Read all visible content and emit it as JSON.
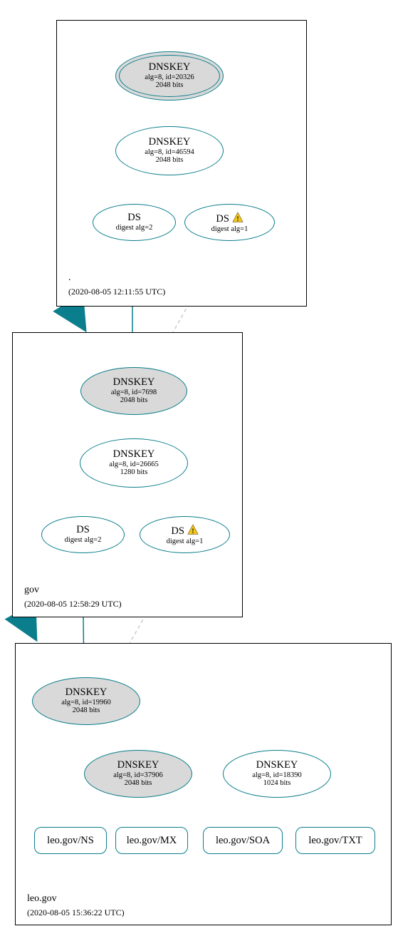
{
  "zones": {
    "root": {
      "name": ".",
      "timestamp": "(2020-08-05 12:11:55 UTC)"
    },
    "gov": {
      "name": "gov",
      "timestamp": "(2020-08-05 12:58:29 UTC)"
    },
    "leo": {
      "name": "leo.gov",
      "timestamp": "(2020-08-05 15:36:22 UTC)"
    }
  },
  "nodes": {
    "root_dnskey1": {
      "title": "DNSKEY",
      "line2": "alg=8, id=20326",
      "line3": "2048 bits"
    },
    "root_dnskey2": {
      "title": "DNSKEY",
      "line2": "alg=8, id=46594",
      "line3": "2048 bits"
    },
    "root_ds1": {
      "title": "DS",
      "line2": "digest alg=2"
    },
    "root_ds2": {
      "title": "DS",
      "line2": "digest alg=1",
      "warn": true
    },
    "gov_dnskey1": {
      "title": "DNSKEY",
      "line2": "alg=8, id=7698",
      "line3": "2048 bits"
    },
    "gov_dnskey2": {
      "title": "DNSKEY",
      "line2": "alg=8, id=26665",
      "line3": "1280 bits"
    },
    "gov_ds1": {
      "title": "DS",
      "line2": "digest alg=2"
    },
    "gov_ds2": {
      "title": "DS",
      "line2": "digest alg=1",
      "warn": true
    },
    "leo_dnskey1": {
      "title": "DNSKEY",
      "line2": "alg=8, id=19960",
      "line3": "2048 bits"
    },
    "leo_dnskey2": {
      "title": "DNSKEY",
      "line2": "alg=8, id=37906",
      "line3": "2048 bits"
    },
    "leo_dnskey3": {
      "title": "DNSKEY",
      "line2": "alg=8, id=18390",
      "line3": "1024 bits"
    }
  },
  "rr": {
    "ns": "leo.gov/NS",
    "mx": "leo.gov/MX",
    "soa": "leo.gov/SOA",
    "txt": "leo.gov/TXT"
  }
}
